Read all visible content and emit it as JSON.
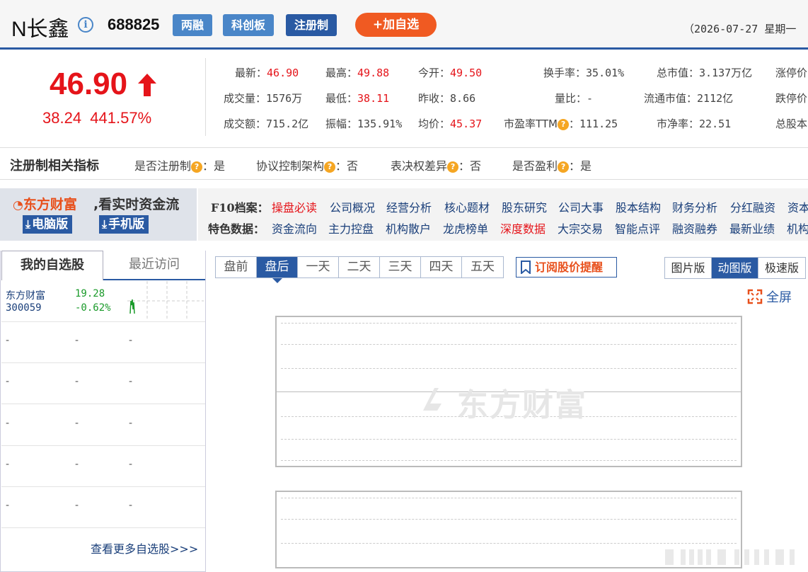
{
  "header": {
    "stock_name": "N长鑫",
    "stock_code": "688825",
    "tags": [
      "两融",
      "科创板",
      "注册制"
    ],
    "add_watch": "+加自选",
    "date": "（2026-07-27 星期一 （"
  },
  "quote": {
    "price": "46.90",
    "change": "38.24",
    "change_pct": "441.57%",
    "latest_label": "最新：",
    "latest": "46.90",
    "high_label": "最高：",
    "high": "49.88",
    "open_label": "今开：",
    "open": "49.50",
    "turnover_label": "换手率：",
    "turnover": "35.01%",
    "mcap_label": "总市值：",
    "mcap": "3.137万亿",
    "limit_up_label": "涨停价",
    "volume_label": "成交量：",
    "volume": "1576万",
    "low_label": "最低：",
    "low": "38.11",
    "prev_close_label": "昨收：",
    "prev_close": "8.66",
    "vol_ratio_label": "量比：",
    "vol_ratio": "-",
    "float_mcap_label": "流通市值：",
    "float_mcap": "2112亿",
    "limit_down_label": "跌停价",
    "amount_label": "成交额：",
    "amount": "715.2亿",
    "amplitude_label": "振幅：",
    "amplitude": "135.91%",
    "avg_label": "均价：",
    "avg": "45.37",
    "pe_label": "市盈率TTM",
    "pe_sep": "：",
    "pe": "111.25",
    "pb_label": "市净率：",
    "pb": "22.51",
    "total_shares_label": "总股本"
  },
  "registration": {
    "title": "注册制相关指标",
    "items": [
      {
        "label": "是否注册制",
        "value": "：是"
      },
      {
        "label": "协议控制架构",
        "value": "：否"
      },
      {
        "label": "表决权差异",
        "value": "：否"
      },
      {
        "label": "是否盈利",
        "value": "：是"
      }
    ]
  },
  "banner": {
    "logo": "东方财富",
    "slogan": ",看实时资金流",
    "pc_btn": "电脑版",
    "mobile_btn": "手机版"
  },
  "f10": {
    "label1": "F10档案：",
    "links1": [
      "操盘必读",
      "公司概况",
      "经营分析",
      "核心题材",
      "股东研究",
      "公司大事",
      "股本结构",
      "财务分析",
      "分红融资",
      "资本"
    ],
    "label2": "特色数据：",
    "links2": [
      "资金流向",
      "主力控盘",
      "机构散户",
      "龙虎榜单",
      "深度数据",
      "大宗交易",
      "智能点评",
      "融资融券",
      "最新业绩",
      "机构"
    ]
  },
  "watchlist": {
    "tab_mine": "我的自选股",
    "tab_recent": "最近访问",
    "rows": [
      {
        "name": "东方财富",
        "code": "300059",
        "price": "19.28",
        "pct": "-0.62%"
      },
      {
        "c1": "-",
        "c2": "-",
        "c3": "-"
      },
      {
        "c1": "-",
        "c2": "-",
        "c3": "-"
      },
      {
        "c1": "-",
        "c2": "-",
        "c3": "-"
      },
      {
        "c1": "-",
        "c2": "-",
        "c3": "-"
      },
      {
        "c1": "-",
        "c2": "-",
        "c3": "-"
      }
    ],
    "more": "查看更多自选股>>>"
  },
  "chart_controls": {
    "period_tabs": [
      "盘前",
      "盘后",
      "一天",
      "二天",
      "三天",
      "四天",
      "五天"
    ],
    "active_period": "盘后",
    "subscribe": "订阅股价提醒",
    "view_tabs": [
      "图片版",
      "动图版",
      "极速版"
    ],
    "active_view": "动图版",
    "fullscreen": "全屏"
  },
  "watermark": "东方财富",
  "colors": {
    "up": "#e5141a",
    "down": "#1a9a2a",
    "brand_blue": "#2a5aa3",
    "brand_orange": "#f05a22"
  }
}
